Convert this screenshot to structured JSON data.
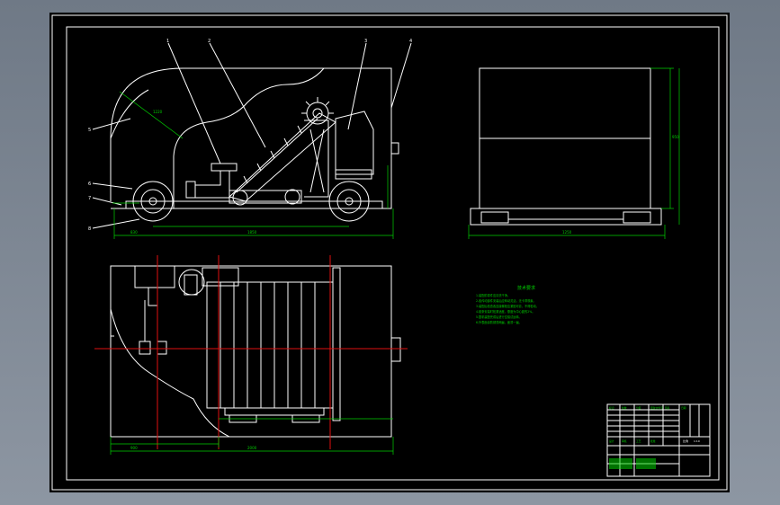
{
  "drawing": {
    "background": "#000000",
    "line_color": "#ffffff",
    "dimension_color": "#00d000",
    "centerline_color": "#e01010",
    "side_view": {
      "callouts": [
        "1",
        "2",
        "3",
        "4",
        "5",
        "6",
        "7",
        "8"
      ],
      "dims": [
        "1220",
        "1850",
        "830"
      ]
    },
    "end_view": {
      "dims": [
        "1250",
        "950"
      ]
    },
    "plan_view": {
      "dims": [
        "2000",
        "900"
      ]
    },
    "notes": {
      "title": "技术要求",
      "lines": [
        "1.装配前零件应清洗干净。",
        "2.各传动部件安装后应转动灵活，无卡滞现象。",
        "3.装配后检查各连接螺栓应紧固可靠，不得松动。",
        "4.链条安装时松紧适度，垂度为中心距的2%。",
        "5.整机装配完成后进行空载试运转。",
        "6.外表面涂防锈漆两遍，面漆一遍。"
      ]
    },
    "title_block": {
      "cells": [
        "标记",
        "处数",
        "分区",
        "更改文件号",
        "签名",
        "日期",
        "设计",
        "审核",
        "工艺",
        "批准",
        "比例",
        "1:10"
      ]
    }
  }
}
